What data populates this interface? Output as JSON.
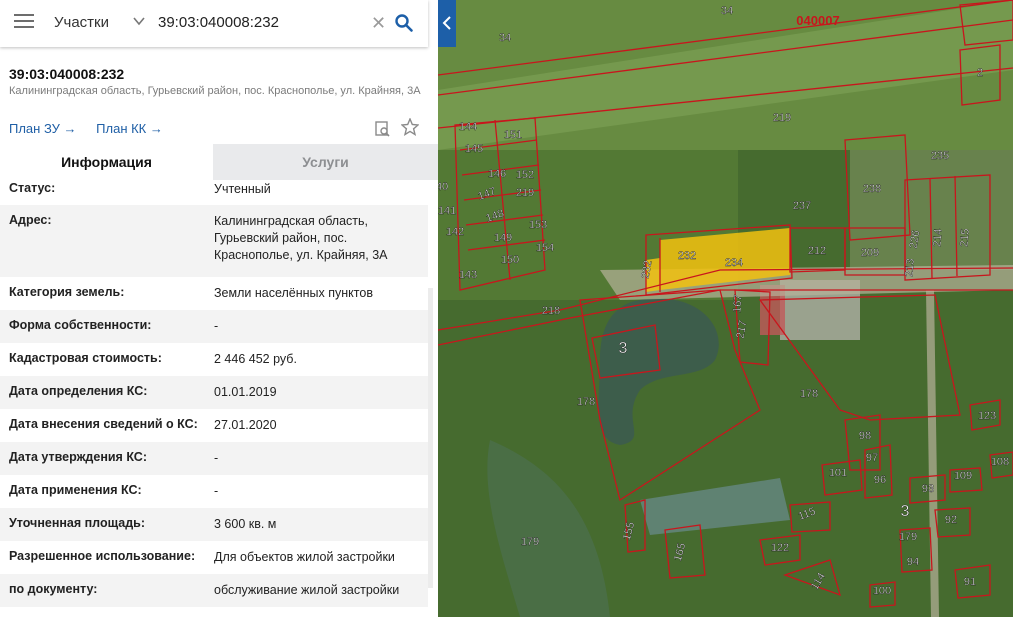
{
  "search": {
    "layer": "Участки",
    "query": "39:03:040008:232"
  },
  "object": {
    "cadastral_number": "39:03:040008:232",
    "address_short": "Калининградская область, Гурьевский район, пос. Краснополье, ул. Крайняя, 3А"
  },
  "links": {
    "plan_zu": "План ЗУ →",
    "plan_kk": "План КК →"
  },
  "tabs": {
    "info": "Информация",
    "services": "Услуги"
  },
  "info": [
    {
      "label": "Статус:",
      "value": "Учтенный"
    },
    {
      "label": "Адрес:",
      "value": "Калининградская область, Гурьевский район, пос. Краснополье, ул. Крайняя, 3А"
    },
    {
      "label": "Категория земель:",
      "value": "Земли населённых пунктов"
    },
    {
      "label": "Форма собственности:",
      "value": "-"
    },
    {
      "label": "Кадастровая стоимость:",
      "value": "2 446 452 руб."
    },
    {
      "label": "Дата определения КС:",
      "value": "01.01.2019"
    },
    {
      "label": "Дата внесения сведений о КС:",
      "value": "27.01.2020"
    },
    {
      "label": "Дата утверждения КС:",
      "value": "-"
    },
    {
      "label": "Дата применения КС:",
      "value": "-"
    },
    {
      "label": "Уточненная площадь:",
      "value": "3 600 кв. м"
    },
    {
      "label": "Разрешенное использование:",
      "value": "Для объектов жилой застройки"
    },
    {
      "label": "по документу:",
      "value": "обслуживание жилой застройки"
    }
  ],
  "map": {
    "quarter_label": "040007",
    "selected_color": "#f2c10f",
    "boundary_color": "#c8161d",
    "parcel_labels": [
      "34",
      "34",
      "2",
      "219",
      "235",
      "144",
      "151",
      "145",
      "146",
      "152",
      "219",
      "147",
      "238",
      "148",
      "153",
      "237",
      "142",
      "149",
      "154",
      "212",
      "209",
      "226",
      "214",
      "215",
      "143",
      "150",
      "232",
      "232",
      "234",
      "213",
      "218",
      "167",
      "217",
      "3",
      "178",
      "178",
      "123",
      "98",
      "97",
      "101",
      "96",
      "108",
      "109",
      "93",
      "115",
      "92",
      "3",
      "155",
      "179",
      "179",
      "122",
      "165",
      "94",
      "114",
      "91",
      "100",
      "40",
      "141"
    ]
  }
}
